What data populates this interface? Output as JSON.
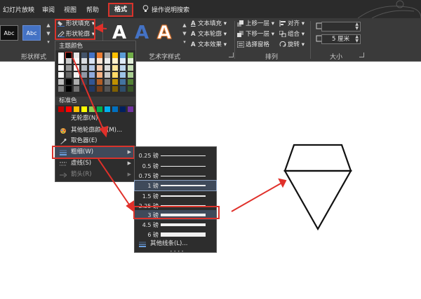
{
  "tabs": [
    "幻灯片放映",
    "审阅",
    "视图",
    "帮助",
    "格式"
  ],
  "search": "操作说明搜索",
  "ribbon": {
    "shape_styles": {
      "label": "形状样式",
      "samples": [
        "Abc",
        "Abc"
      ],
      "fill": "形状填充",
      "outline": "形状轮廓"
    },
    "wordart": {
      "label": "艺术字样式",
      "samples": [
        "A",
        "A",
        "A"
      ],
      "text_fill": "文本填充",
      "text_outline": "文本轮廓",
      "text_effect": "文本效果"
    },
    "arrange": {
      "label": "排列",
      "bring_forward": "上移一层",
      "send_backward": "下移一层",
      "selection_pane": "选择窗格",
      "align": "对齐",
      "group": "组合",
      "rotate": "旋转"
    },
    "size": {
      "label": "大小",
      "width_value": "5 厘米"
    }
  },
  "color_menu": {
    "theme_header": "主题颜色",
    "standard_header": "标准色",
    "no_outline": "无轮廓(N)",
    "more_colors": "其他轮廓颜色(M)...",
    "eyedropper": "取色器(E)",
    "weight": "粗细(W)",
    "dashes": "虚线(S)",
    "arrows": "箭头(R)"
  },
  "weight_menu": {
    "items": [
      "0.25 磅",
      "0.5 磅",
      "0.75 磅",
      "1 磅",
      "1.5 磅",
      "2.25 磅",
      "3 磅",
      "4.5 磅",
      "6 磅"
    ],
    "more_lines": "其他线条(L)..."
  },
  "colors": {
    "accent_red": "#d9332b",
    "tab_bar": "#2b2b2b",
    "ribbon": "#3a3a3a",
    "menu": "#2d2d2d"
  }
}
